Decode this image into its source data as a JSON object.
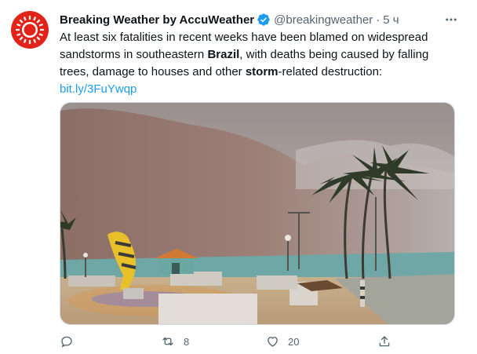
{
  "tweet": {
    "author_name": "Breaking Weather by AccuWeather",
    "handle": "@breakingweather",
    "separator": "·",
    "time": "5 ч",
    "text_parts": {
      "p1": "At least six fatalities in recent weeks have been blamed on widespread sandstorms in southeastern ",
      "b1": "Brazil",
      "p2": ", with deaths being caused by falling trees, damage to houses and other ",
      "b2": "storm",
      "p3": "-related destruction:"
    },
    "link": "bit.ly/3FuYwqp"
  },
  "actions": {
    "reply_count": "",
    "retweet_count": "8",
    "like_count": "20"
  },
  "colors": {
    "accent": "#1d9bf0",
    "brand": "#e2231a",
    "muted": "#536471"
  }
}
